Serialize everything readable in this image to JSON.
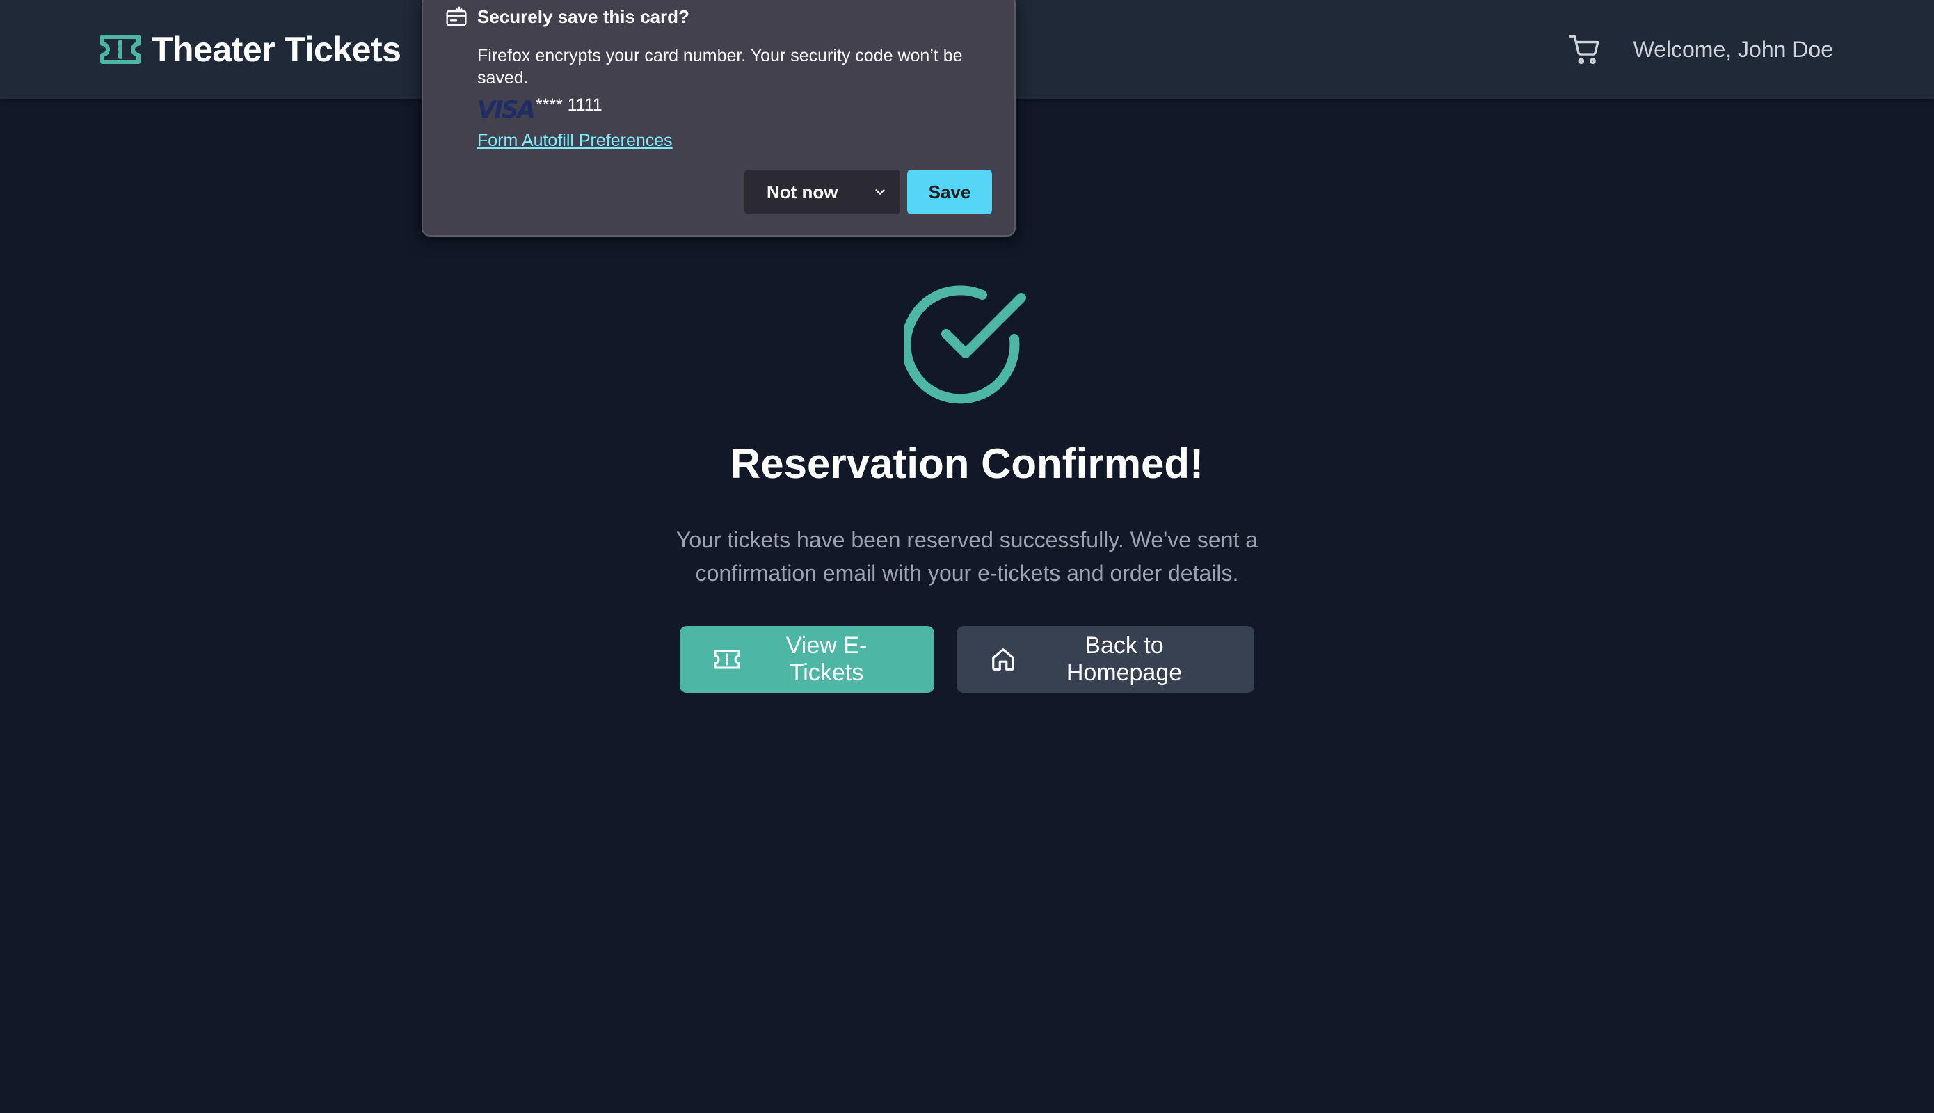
{
  "header": {
    "brand_title": "Theater Tickets",
    "welcome_text": "Welcome, John Doe",
    "brand_icon": "ticket-icon",
    "cart_icon": "cart-icon"
  },
  "main": {
    "status_icon": "check-circle-icon",
    "title": "Reservation Confirmed!",
    "description": "Your tickets have been reserved successfully. We've sent a confirmation email with your e-tickets and order details.",
    "view_tickets_label": "View E-Tickets",
    "back_home_label": "Back to Homepage"
  },
  "popup": {
    "title": "Securely save this card?",
    "message": "Firefox encrypts your card number. Your security code won’t be saved.",
    "card_brand": "VISA",
    "card_number": "**** 1111",
    "preferences_link": "Form Autofill Preferences",
    "not_now_label": "Not now",
    "save_label": "Save"
  },
  "colors": {
    "accent": "#4db6a5",
    "background": "#111827",
    "header_bg": "#1f2937",
    "secondary_button": "#374151",
    "popup_bg": "#42414d",
    "popup_save": "#56d6f6",
    "link": "#80ebff"
  }
}
